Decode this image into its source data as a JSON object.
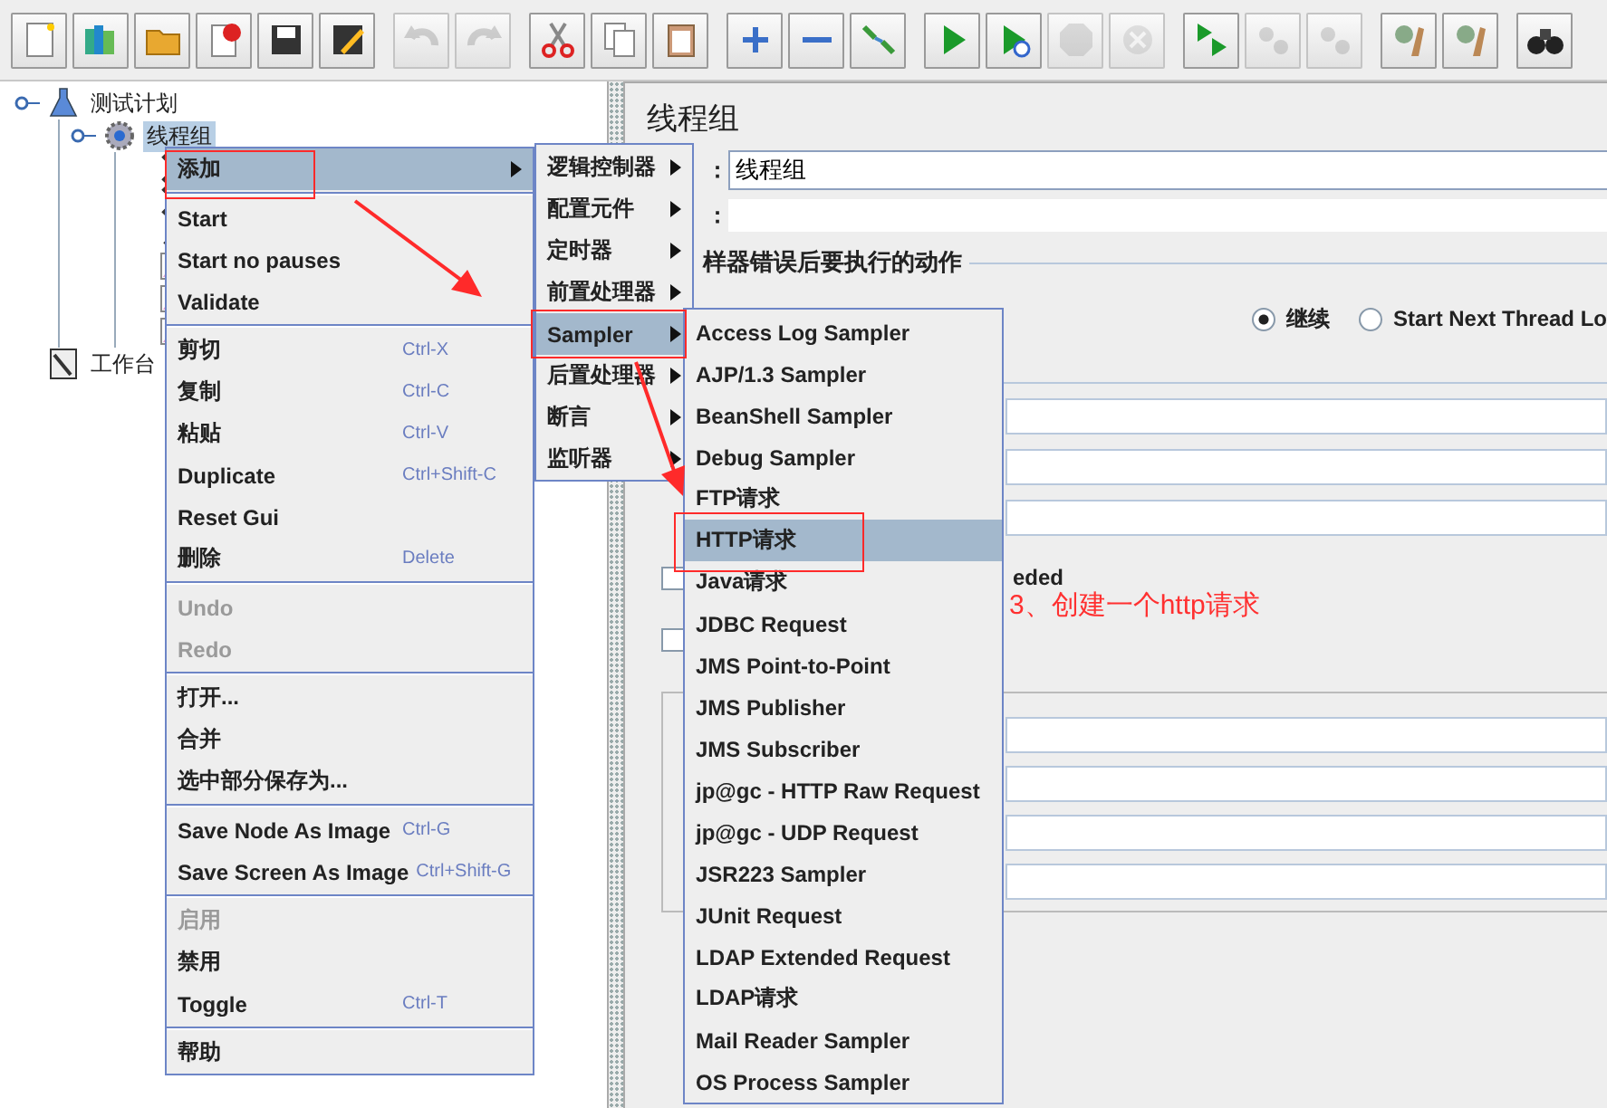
{
  "toolbar_groups": [
    {
      "buttons": [
        {
          "kind": "new",
          "disabled": false
        },
        {
          "kind": "templates",
          "disabled": false
        },
        {
          "kind": "open",
          "disabled": false
        },
        {
          "kind": "close",
          "disabled": false
        },
        {
          "kind": "save",
          "disabled": false
        },
        {
          "kind": "save-as",
          "disabled": false
        }
      ]
    },
    {
      "buttons": [
        {
          "kind": "undo",
          "disabled": true
        },
        {
          "kind": "redo",
          "disabled": true
        }
      ]
    },
    {
      "buttons": [
        {
          "kind": "cut",
          "disabled": false
        },
        {
          "kind": "copy",
          "disabled": false
        },
        {
          "kind": "paste",
          "disabled": false
        }
      ]
    },
    {
      "buttons": [
        {
          "kind": "expand",
          "disabled": false
        },
        {
          "kind": "collapse",
          "disabled": false
        },
        {
          "kind": "toggle",
          "disabled": false
        }
      ]
    },
    {
      "buttons": [
        {
          "kind": "start",
          "disabled": false
        },
        {
          "kind": "start-no-pause",
          "disabled": false
        },
        {
          "kind": "stop",
          "disabled": true
        },
        {
          "kind": "shutdown",
          "disabled": true
        }
      ]
    },
    {
      "buttons": [
        {
          "kind": "remote-start",
          "disabled": false
        },
        {
          "kind": "remote-stop",
          "disabled": true
        },
        {
          "kind": "remote-exit",
          "disabled": true
        }
      ]
    },
    {
      "buttons": [
        {
          "kind": "clear",
          "disabled": false
        },
        {
          "kind": "clear-all",
          "disabled": false
        }
      ]
    },
    {
      "buttons": [
        {
          "kind": "search",
          "disabled": false
        }
      ]
    }
  ],
  "tree": [
    {
      "label": "测试计划",
      "kind": "plan",
      "selected": false,
      "children": [
        {
          "label": "线程组",
          "kind": "thread-group",
          "selected": true,
          "children": [
            {
              "kind": "config"
            },
            {
              "kind": "config"
            },
            {
              "kind": "pre"
            },
            {
              "kind": "listener"
            },
            {
              "kind": "listener"
            },
            {
              "kind": "listener"
            }
          ]
        }
      ]
    },
    {
      "label": "工作台",
      "kind": "workbench",
      "selected": false
    }
  ],
  "panel": {
    "title": "线程组",
    "name_label": "：",
    "name_value": "线程组",
    "comment_label": "：",
    "section": "样器错误后要执行的动作",
    "radios": [
      {
        "label": "继续",
        "selected": true
      },
      {
        "label": "Start Next Thread Lo",
        "selected": false
      }
    ],
    "checks": [
      {
        "label": "eded",
        "checked": false
      },
      {
        "checked": false
      }
    ]
  },
  "context_menu": {
    "items": [
      {
        "kind": "item",
        "label": "添加",
        "selected": true,
        "disabled": false,
        "submenu": true
      },
      {
        "kind": "separator"
      },
      {
        "kind": "item",
        "label": "Start",
        "selected": false,
        "disabled": false,
        "submenu": false
      },
      {
        "kind": "item",
        "label": "Start no pauses",
        "selected": false,
        "disabled": false,
        "submenu": false
      },
      {
        "kind": "item",
        "label": "Validate",
        "selected": false,
        "disabled": false,
        "submenu": false
      },
      {
        "kind": "separator"
      },
      {
        "kind": "item",
        "label": "剪切",
        "shortcut": "Ctrl-X",
        "selected": false,
        "disabled": false,
        "submenu": false
      },
      {
        "kind": "item",
        "label": "复制",
        "shortcut": "Ctrl-C",
        "selected": false,
        "disabled": false,
        "submenu": false
      },
      {
        "kind": "item",
        "label": "粘贴",
        "shortcut": "Ctrl-V",
        "selected": false,
        "disabled": false,
        "submenu": false
      },
      {
        "kind": "item",
        "label": "Duplicate",
        "shortcut": "Ctrl+Shift-C",
        "selected": false,
        "disabled": false,
        "submenu": false
      },
      {
        "kind": "item",
        "label": "Reset Gui",
        "selected": false,
        "disabled": false,
        "submenu": false
      },
      {
        "kind": "item",
        "label": "删除",
        "shortcut": "Delete",
        "selected": false,
        "disabled": false,
        "submenu": false
      },
      {
        "kind": "separator"
      },
      {
        "kind": "item",
        "label": "Undo",
        "selected": false,
        "disabled": true,
        "submenu": false
      },
      {
        "kind": "item",
        "label": "Redo",
        "selected": false,
        "disabled": true,
        "submenu": false
      },
      {
        "kind": "separator"
      },
      {
        "kind": "item",
        "label": "打开...",
        "selected": false,
        "disabled": false,
        "submenu": false
      },
      {
        "kind": "item",
        "label": "合并",
        "selected": false,
        "disabled": false,
        "submenu": false
      },
      {
        "kind": "item",
        "label": "选中部分保存为...",
        "selected": false,
        "disabled": false,
        "submenu": false
      },
      {
        "kind": "separator"
      },
      {
        "kind": "item",
        "label": "Save Node As Image",
        "shortcut": "Ctrl-G",
        "selected": false,
        "disabled": false,
        "submenu": false
      },
      {
        "kind": "item",
        "label": "Save Screen As Image",
        "shortcut": "Ctrl+Shift-G",
        "selected": false,
        "disabled": false,
        "submenu": false
      },
      {
        "kind": "separator"
      },
      {
        "kind": "item",
        "label": "启用",
        "selected": false,
        "disabled": true,
        "submenu": false
      },
      {
        "kind": "item",
        "label": "禁用",
        "selected": false,
        "disabled": false,
        "submenu": false
      },
      {
        "kind": "item",
        "label": "Toggle",
        "shortcut": "Ctrl-T",
        "selected": false,
        "disabled": false,
        "submenu": false
      },
      {
        "kind": "separator"
      },
      {
        "kind": "item",
        "label": "帮助",
        "selected": false,
        "disabled": false,
        "submenu": false
      }
    ]
  },
  "add_submenu": {
    "items": [
      {
        "label": "逻辑控制器",
        "selected": false
      },
      {
        "label": "配置元件",
        "selected": false
      },
      {
        "label": "定时器",
        "selected": false
      },
      {
        "label": "前置处理器",
        "selected": false
      },
      {
        "label": "Sampler",
        "selected": true
      },
      {
        "label": "后置处理器",
        "selected": false
      },
      {
        "label": "断言",
        "selected": false
      },
      {
        "label": "监听器",
        "selected": false
      }
    ]
  },
  "sampler_submenu": {
    "items": [
      {
        "label": "Access Log Sampler",
        "selected": false
      },
      {
        "label": "AJP/1.3 Sampler",
        "selected": false
      },
      {
        "label": "BeanShell Sampler",
        "selected": false
      },
      {
        "label": "Debug Sampler",
        "selected": false
      },
      {
        "label": "FTP请求",
        "selected": false
      },
      {
        "label": "HTTP请求",
        "selected": true
      },
      {
        "label": "Java请求",
        "selected": false
      },
      {
        "label": "JDBC Request",
        "selected": false
      },
      {
        "label": "JMS Point-to-Point",
        "selected": false
      },
      {
        "label": "JMS Publisher",
        "selected": false
      },
      {
        "label": "JMS Subscriber",
        "selected": false
      },
      {
        "label": "jp@gc - HTTP Raw Request",
        "selected": false
      },
      {
        "label": "jp@gc - UDP Request",
        "selected": false
      },
      {
        "label": "JSR223 Sampler",
        "selected": false
      },
      {
        "label": "JUnit Request",
        "selected": false
      },
      {
        "label": "LDAP Extended Request",
        "selected": false
      },
      {
        "label": "LDAP请求",
        "selected": false
      },
      {
        "label": "Mail Reader Sampler",
        "selected": false
      },
      {
        "label": "OS Process Sampler",
        "selected": false
      }
    ]
  },
  "annotation": {
    "text": "3、创建一个http请求"
  }
}
